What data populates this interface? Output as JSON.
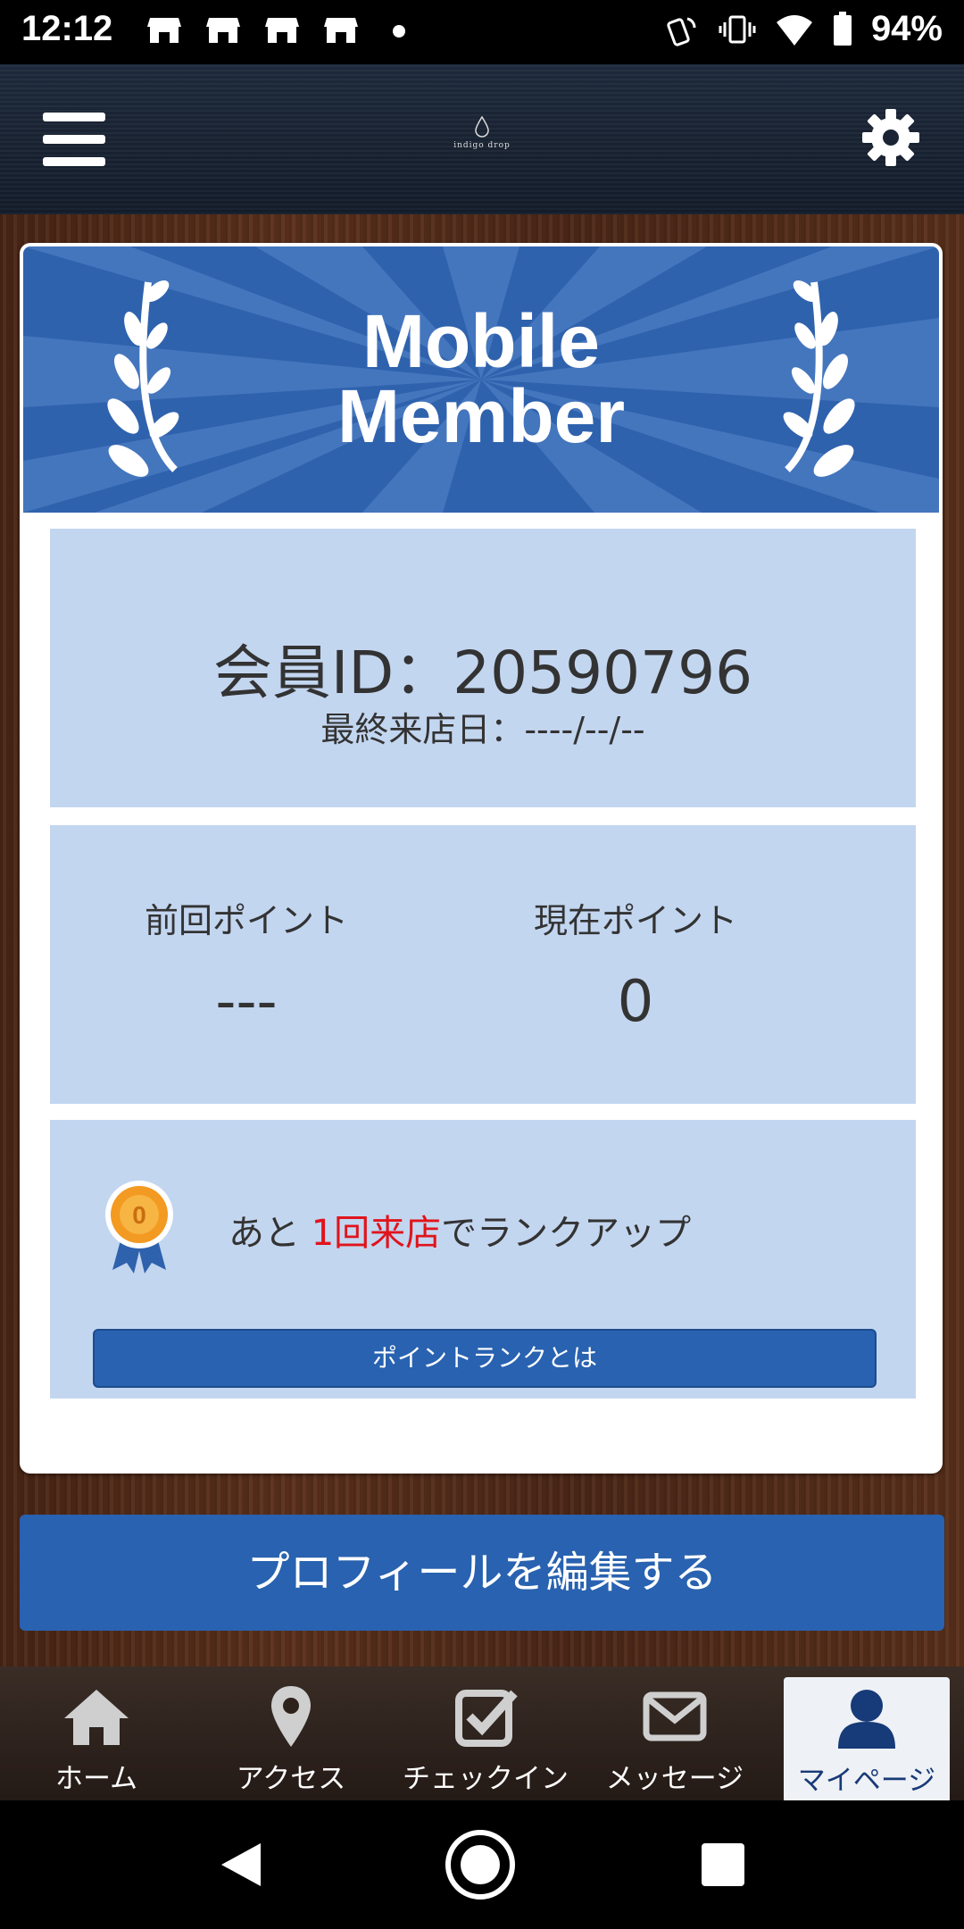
{
  "status_bar": {
    "time": "12:12",
    "battery": "94%"
  },
  "header": {
    "logo_text": "indigo drop",
    "menu_icon": "hamburger-icon",
    "settings_icon": "gear-icon"
  },
  "card": {
    "banner_title_line1": "Mobile",
    "banner_title_line2": "Member",
    "member_id": "会員ID：20590796",
    "last_visit": "最終来店日：----/--/--",
    "points": {
      "previous_label": "前回ポイント",
      "previous_value": "---",
      "current_label": "現在ポイント",
      "current_value": "0"
    },
    "rank": {
      "prefix": "あと ",
      "highlight": "1回来店",
      "suffix": "でランクアップ",
      "button_label": "ポイントランクとは"
    }
  },
  "edit_profile_button": "プロフィールを編集する",
  "tabs": [
    {
      "label": "ホーム",
      "icon": "home-icon"
    },
    {
      "label": "アクセス",
      "icon": "map-pin-icon"
    },
    {
      "label": "チェックイン",
      "icon": "checkbox-icon"
    },
    {
      "label": "メッセージ",
      "icon": "envelope-icon"
    },
    {
      "label": "マイページ",
      "icon": "user-icon",
      "active": true
    }
  ],
  "colors": {
    "accent": "#2862b0",
    "panel": "#c3d6f0",
    "highlight_red": "#e0141c"
  }
}
